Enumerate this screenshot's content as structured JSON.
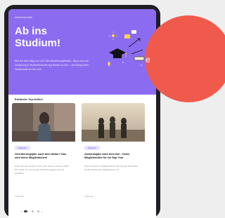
{
  "hero": {
    "eyebrow": "Abiturientenhilfe",
    "title_line1": "Ab ins",
    "title_line2": "Studium!",
    "body": "Bist auf dem Weg zur Uni? Alle Bewerbungsfristen, Tipps rund um Zulassung & Studienfinanzierung findest du hier – viel Erfolg beim Studienstart an der Uni!"
  },
  "section_title": "Entdecke Top-Artikel",
  "cards": [
    {
      "tag": "Ratgeber",
      "title": "Orientierungsjahr nach dem Abitur? Das sind deine Möglichkeiten!",
      "desc": "Nach dem Abi weißt du noch nicht, was du machen willst? Wir zeigen dir, wie du dein Orientierungsjahr sinnvoll gestaltest.",
      "more": "2 Minuten"
    },
    {
      "tag": "Ratgeber",
      "title": "Auslandsjahr nach dem Abi – Deine Möglichkeiten für ein Gap Year",
      "desc": "Work & Travel, Freiwilligendienst oder Au-pair: Wir stellen dir die beliebtesten Möglichkeiten vor.",
      "more": "3 Minuten"
    }
  ],
  "pager": {
    "prev": "‹",
    "next": "›"
  },
  "overlay": {
    "text": "e"
  },
  "colors": {
    "hero": "#8b6cf0",
    "accent": "#f05a4c"
  }
}
